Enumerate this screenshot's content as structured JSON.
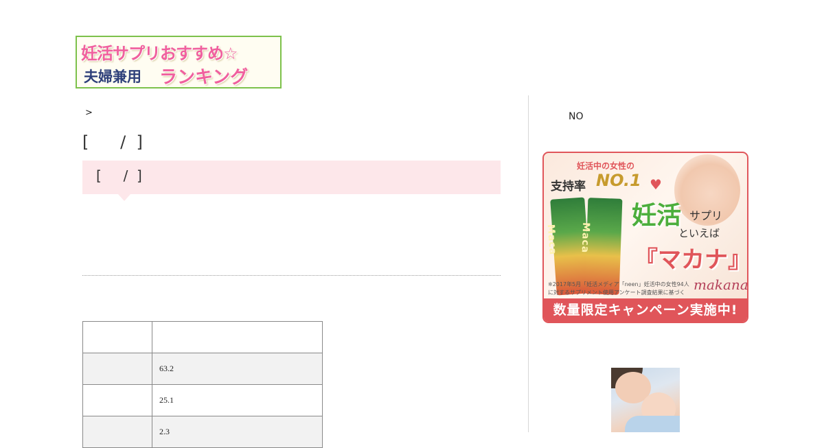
{
  "logo": {
    "line1": "妊活サプリおすすめ☆",
    "line2a": "夫婦兼用",
    "line2b": "ランキング"
  },
  "breadcrumb": {
    "separator": ">"
  },
  "page_title": "[      /  ]",
  "callout": {
    "text": "[     /  ]"
  },
  "table": {
    "rows": [
      {
        "label": "",
        "value": ""
      },
      {
        "label": "",
        "value": "63.2"
      },
      {
        "label": "",
        "value": "25.1"
      },
      {
        "label": "",
        "value": "2.3"
      }
    ]
  },
  "sidebar": {
    "heading": "NO",
    "banner": {
      "subtitle": "妊活中の女性の",
      "rate": "支持率",
      "no1": "NO.1",
      "pack_label": "Maca",
      "ninkatsu": "妊活",
      "supuri": "サプリ",
      "ieba": "といえば",
      "makana": "『マカナ』",
      "note": "※2017年5月「妊活メディア「neen」妊活中の女性94人に対するサプリメント使用アンケート調査結果に基づく",
      "brand": "makana",
      "campaign": "数量限定キャンペーン実施中!"
    }
  },
  "colors": {
    "accent_pink": "#f0609e",
    "callout_bg": "#fde7ea",
    "banner_red": "#e0555a",
    "logo_border": "#7cc14a"
  }
}
